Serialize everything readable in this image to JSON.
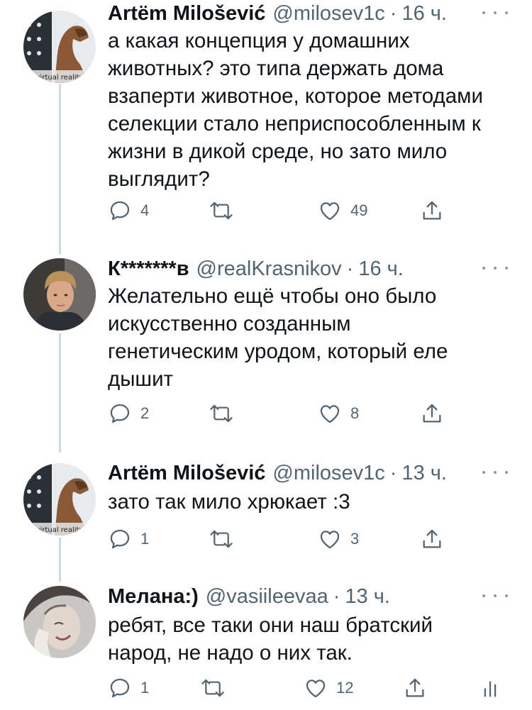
{
  "tweets": [
    {
      "name": "Artëm Milošević",
      "handle": "@milosev1c",
      "time": "16 ч.",
      "lines": [
        "а какая концепция у домашних",
        "животных? это типа держать дома",
        "взаперти животное, которое методами",
        "селекции стало неприспособленным к",
        "жизни в дикой среде, но зато мило",
        "выглядит?"
      ],
      "replies": "4",
      "likes": "49",
      "avatar_caption": "virtual reality"
    },
    {
      "name": "К*******в",
      "handle": "@realKrasnikov",
      "time": "16 ч.",
      "lines": [
        "Желательно ещё чтобы оно было",
        "искусственно созданным",
        "генетическим уродом, который еле",
        "дышит"
      ],
      "replies": "2",
      "likes": "8"
    },
    {
      "name": "Artëm Milošević",
      "handle": "@milosev1c",
      "time": "13 ч.",
      "lines": [
        "зато так мило хрюкает :3"
      ],
      "replies": "1",
      "likes": "3",
      "avatar_caption": "virtual reality"
    },
    {
      "name": "Мелана:)",
      "handle": "@vasiileevaa",
      "time": "13 ч.",
      "lines": [
        "ребят, все таки они наш братский",
        "народ, не надо о них так."
      ],
      "replies": "1",
      "likes": "12"
    }
  ],
  "separator": "·",
  "colors": {
    "text": "#0f1419",
    "secondary": "#536471",
    "thread_line": "#cfd9de"
  },
  "icons": [
    "reply-icon",
    "retweet-icon",
    "like-icon",
    "share-icon",
    "analytics-icon",
    "more-icon"
  ]
}
